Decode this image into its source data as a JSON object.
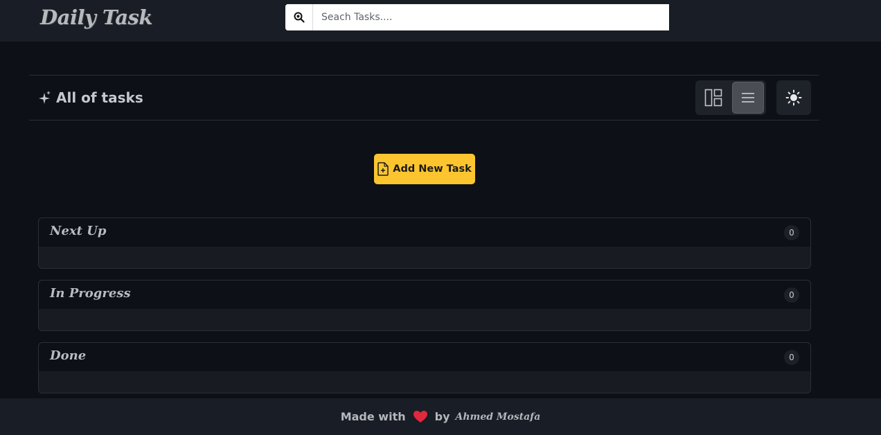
{
  "header": {
    "logo": "Daily Task",
    "search": {
      "placeholder": "Seach Tasks....",
      "value": ""
    }
  },
  "titlebar": {
    "title": "All of tasks",
    "view_options": [
      "grid-view",
      "list-view"
    ],
    "active_view": "list-view"
  },
  "actions": {
    "add_task_label": "Add New Task"
  },
  "sections": [
    {
      "title": "Next Up",
      "count": "0"
    },
    {
      "title": "In Progress",
      "count": "0"
    },
    {
      "title": "Done",
      "count": "0"
    }
  ],
  "footer": {
    "made_with": "Made with",
    "by": "by",
    "author": "Ahmed Mostafa"
  },
  "colors": {
    "background": "#0d1017",
    "header": "#191d25",
    "accent": "#fcc52f",
    "heart": "#e0283e"
  },
  "icons": [
    "search-icon",
    "sparkles-icon",
    "grid-view-icon",
    "list-view-icon",
    "sun-icon",
    "file-plus-icon",
    "heart-icon"
  ]
}
